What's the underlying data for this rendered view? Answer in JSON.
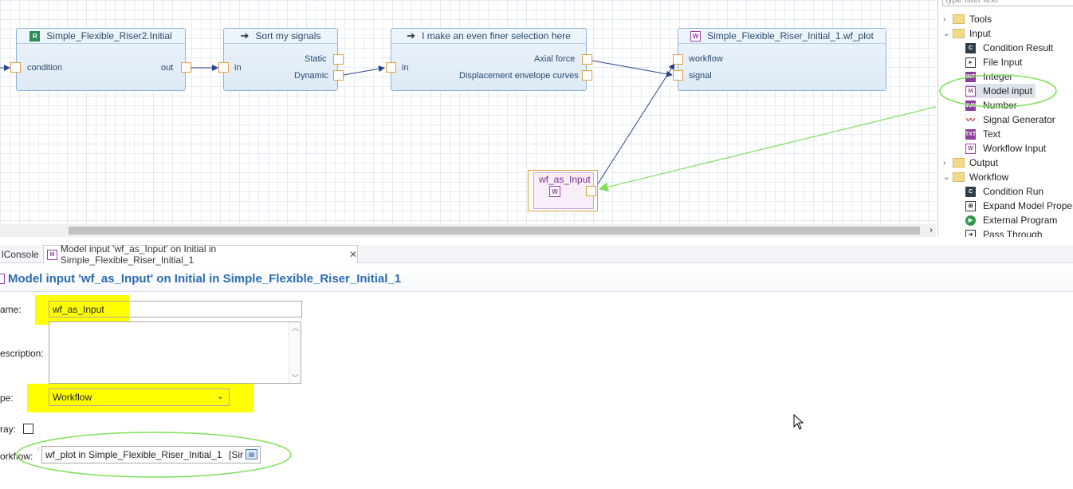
{
  "canvas": {
    "nodes": [
      {
        "title": "Simple_Flexible_Riser2.Initial",
        "icon": "R",
        "in": "condition",
        "out": "out"
      },
      {
        "title": "Sort my signals",
        "icon": "arrow",
        "in": "in",
        "out1": "Static",
        "out2": "Dynamic"
      },
      {
        "title": "I make an even finer selection here",
        "icon": "arrow",
        "in": "in",
        "out1": "Axial force",
        "out2": "Displacement envelope curves"
      },
      {
        "title": "Simple_Flexible_Riser_Initial_1.wf_plot",
        "icon": "W",
        "in1": "workflow",
        "in2": "signal"
      }
    ],
    "input_node": {
      "title": "wf_as_Input"
    }
  },
  "palette": {
    "filter_placeholder": "type filter text",
    "items": [
      {
        "label": "Tools",
        "type": "folder",
        "expanded": false
      },
      {
        "label": "Input",
        "type": "folder",
        "expanded": true
      },
      {
        "label": "Condition Result",
        "icon": "C"
      },
      {
        "label": "File Input",
        "icon": "file"
      },
      {
        "label": "Integer",
        "icon": "INT"
      },
      {
        "label": "Model input",
        "icon": "M"
      },
      {
        "label": "Number",
        "icon": "NUM"
      },
      {
        "label": "Signal Generator",
        "icon": "sig"
      },
      {
        "label": "Text",
        "icon": "TXT"
      },
      {
        "label": "Workflow Input",
        "icon": "W"
      },
      {
        "label": "Output",
        "type": "folder",
        "expanded": false
      },
      {
        "label": "Workflow",
        "type": "folder",
        "expanded": true
      },
      {
        "label": "Condition Run",
        "icon": "C"
      },
      {
        "label": "Expand Model Proper",
        "icon": "expand"
      },
      {
        "label": "External Program",
        "icon": "play"
      },
      {
        "label": "Pass Through",
        "icon": "arrow"
      }
    ]
  },
  "tabs": [
    {
      "label": "lConsole"
    },
    {
      "label": "Model input 'wf_as_Input' on Initial in Simple_Flexible_Riser_Initial_1",
      "close": "✕"
    }
  ],
  "editor": {
    "title": "Model input 'wf_as_Input' on Initial in Simple_Flexible_Riser_Initial_1",
    "name_label": "ame:",
    "name_value": "wf_as_Input",
    "description_label": "escription:",
    "description_value": "",
    "type_label": "pe:",
    "type_value": "Workflow",
    "array_label": "ray:",
    "array_checked": false,
    "workflow_label": "orkflow:",
    "workflow_value": "wf_plot in Simple_Flexible_Riser_Initial_1",
    "workflow_suffix": "[Sir"
  },
  "colors": {
    "highlight": "#ffff00",
    "annotation": "#7ee05a",
    "link": "#2a3f8f"
  }
}
